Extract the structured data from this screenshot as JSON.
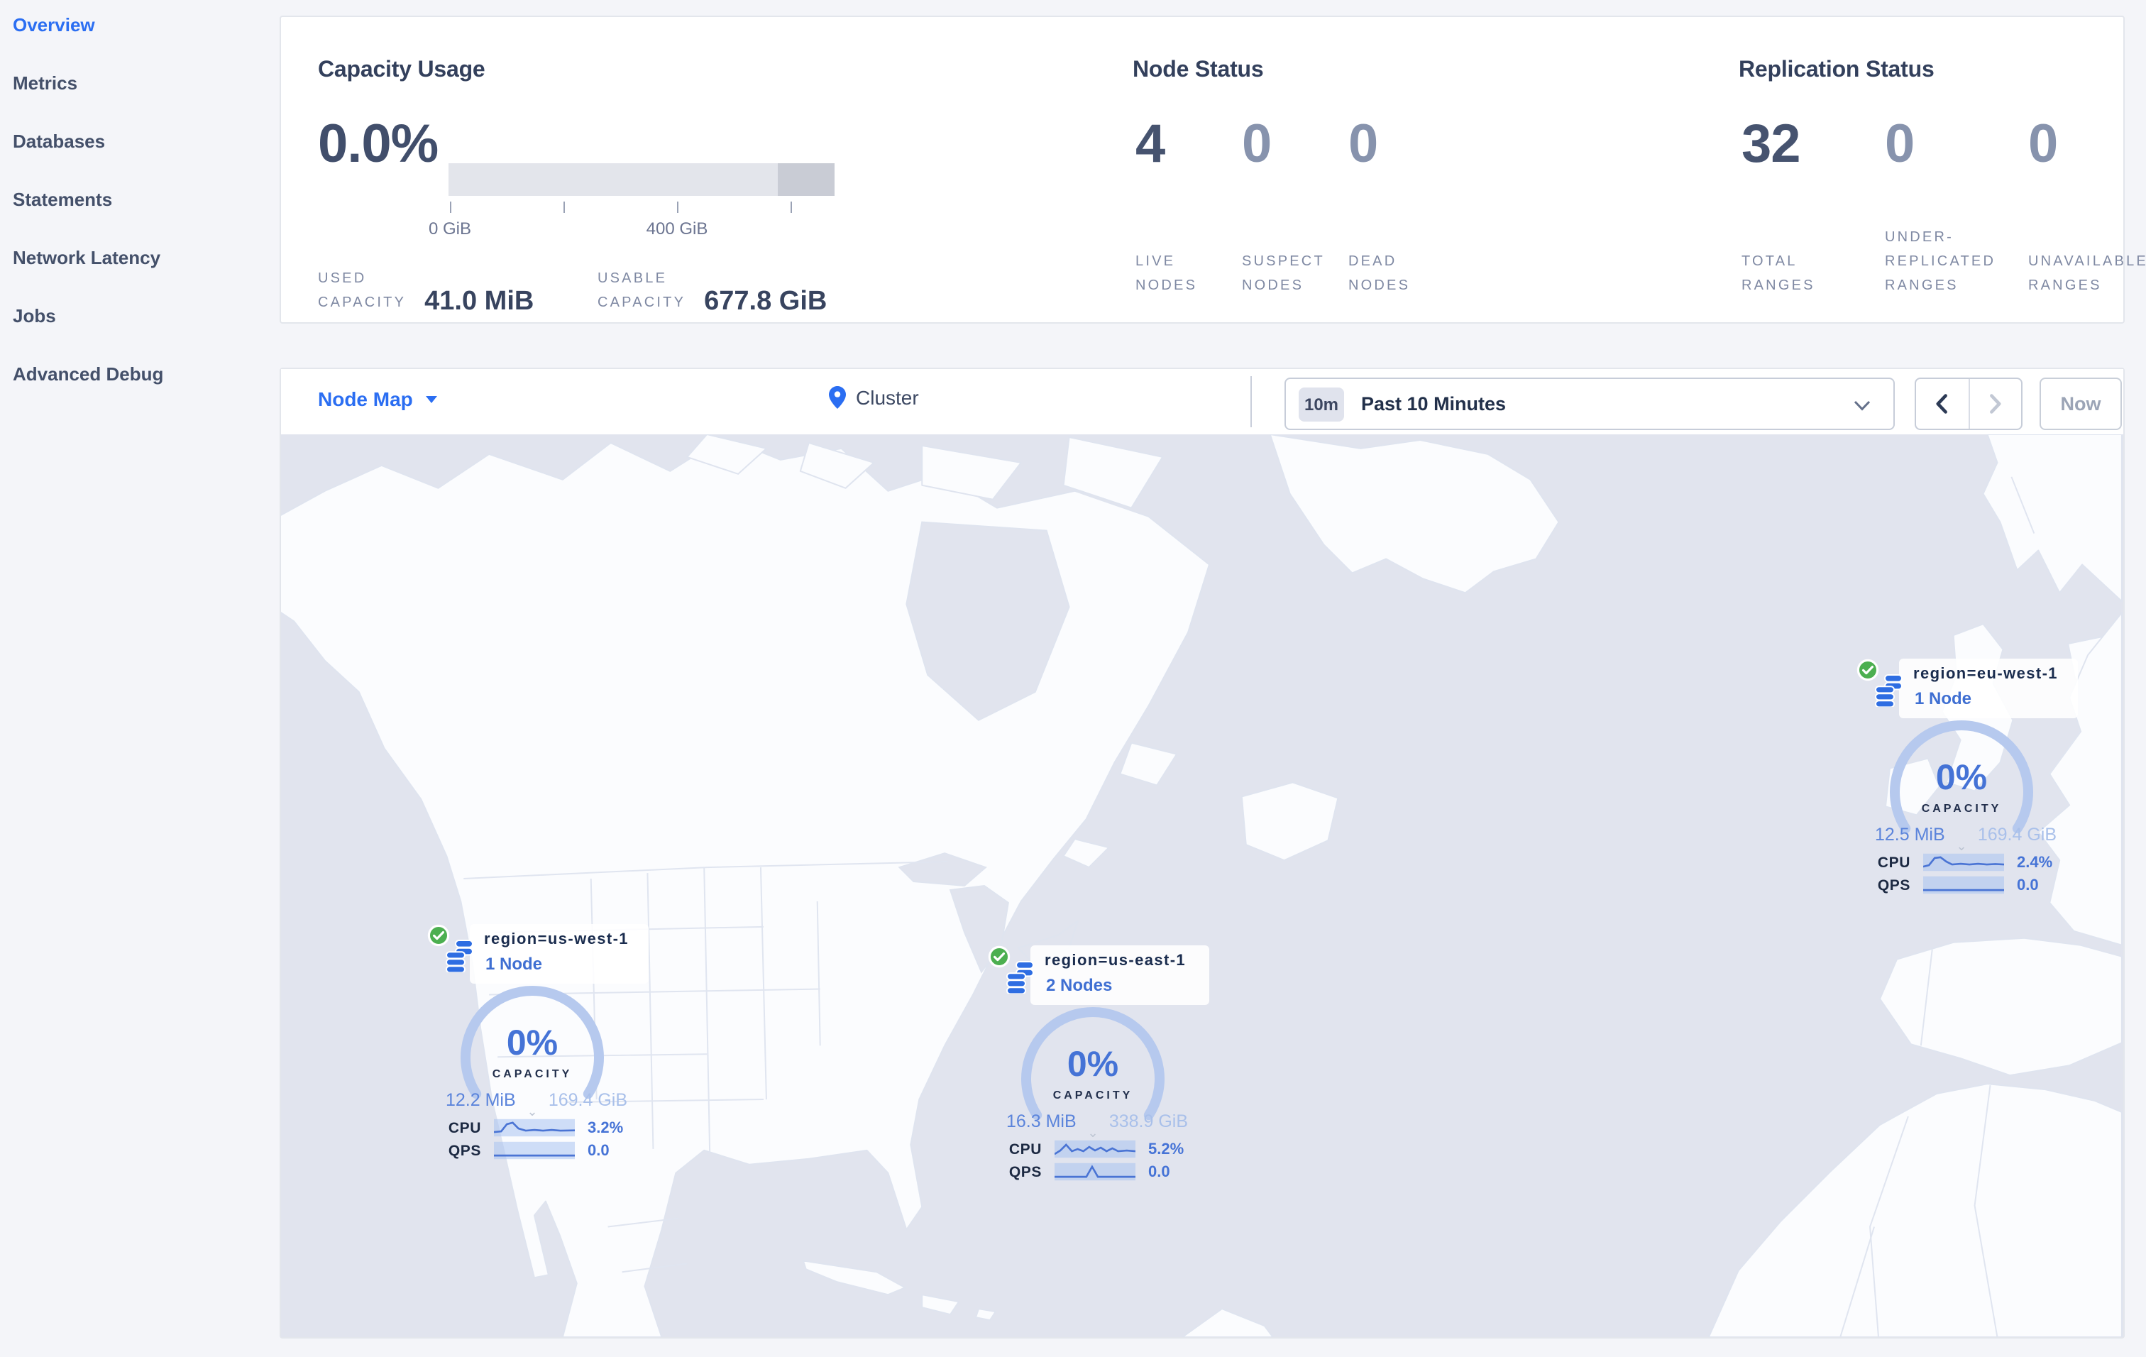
{
  "sidebar": {
    "items": [
      {
        "label": "Overview",
        "active": true
      },
      {
        "label": "Metrics",
        "active": false
      },
      {
        "label": "Databases",
        "active": false
      },
      {
        "label": "Statements",
        "active": false
      },
      {
        "label": "Network Latency",
        "active": false
      },
      {
        "label": "Jobs",
        "active": false
      },
      {
        "label": "Advanced Debug",
        "active": false
      }
    ]
  },
  "summary": {
    "capacity": {
      "title": "Capacity Usage",
      "percent": "0.0%",
      "tick_start": "0 GiB",
      "tick_mid": "400 GiB",
      "used_label_1": "USED",
      "used_label_2": "CAPACITY",
      "used_value": "41.0 MiB",
      "usable_label_1": "USABLE",
      "usable_label_2": "CAPACITY",
      "usable_value": "677.8 GiB"
    },
    "nodes": {
      "title": "Node Status",
      "stats": [
        {
          "value": "4",
          "label_1": "LIVE",
          "label_2": "NODES"
        },
        {
          "value": "0",
          "label_1": "SUSPECT",
          "label_2": "NODES"
        },
        {
          "value": "0",
          "label_1": "DEAD",
          "label_2": "NODES"
        }
      ]
    },
    "replication": {
      "title": "Replication Status",
      "stats": [
        {
          "value": "32",
          "label_1": "TOTAL",
          "label_2": "RANGES",
          "label_3": ""
        },
        {
          "value": "0",
          "label_1": "UNDER-",
          "label_2": "REPLICATED",
          "label_3": "RANGES"
        },
        {
          "value": "0",
          "label_1": "UNAVAILABLE",
          "label_2": "RANGES",
          "label_3": ""
        }
      ]
    }
  },
  "toolbar": {
    "view_selector": "Node Map",
    "breadcrumb": "Cluster",
    "time_badge": "10m",
    "time_label": "Past 10 Minutes",
    "now_label": "Now"
  },
  "map": {
    "markers": [
      {
        "region": "region=us-west-1",
        "nodes": "1 Node",
        "percent": "0%",
        "capacity_label": "CAPACITY",
        "used": "12.2 MiB",
        "capacity_total": "169.4 GiB",
        "cpu_label": "CPU",
        "cpu_value": "3.2%",
        "qps_label": "QPS",
        "qps_value": "0.0"
      },
      {
        "region": "region=us-east-1",
        "nodes": "2 Nodes",
        "percent": "0%",
        "capacity_label": "CAPACITY",
        "used": "16.3 MiB",
        "capacity_total": "338.9 GiB",
        "cpu_label": "CPU",
        "cpu_value": "5.2%",
        "qps_label": "QPS",
        "qps_value": "0.0"
      },
      {
        "region": "region=eu-west-1",
        "nodes": "1 Node",
        "percent": "0%",
        "capacity_label": "CAPACITY",
        "used": "12.5 MiB",
        "capacity_total": "169.4 GiB",
        "cpu_label": "CPU",
        "cpu_value": "2.4%",
        "qps_label": "QPS",
        "qps_value": "0.0"
      }
    ]
  },
  "colors": {
    "accent_blue": "#2b6ef2",
    "marker_blue": "#4573d6",
    "arc_light_blue": "#b6c9ee",
    "status_green": "#4caf50",
    "sea": "#e1e4ee",
    "land": "#fbfcfe",
    "heading": "#33405c",
    "muted_number": "#8793ad"
  }
}
